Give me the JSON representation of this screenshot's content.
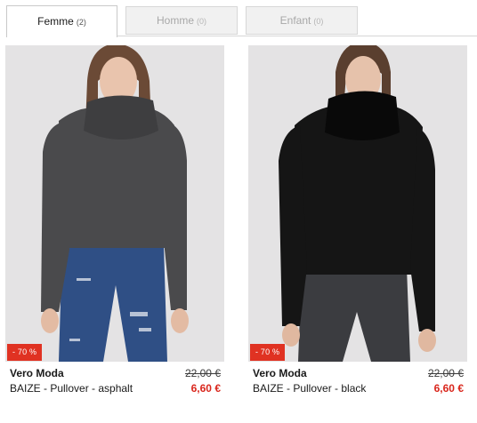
{
  "tabs": [
    {
      "label": "Femme",
      "count": "(2)",
      "active": true
    },
    {
      "label": "Homme",
      "count": "(0)",
      "active": false
    },
    {
      "label": "Enfant",
      "count": "(0)",
      "active": false
    }
  ],
  "products": [
    {
      "badge": "- 70 %",
      "brand": "Vero Moda",
      "name": "BAIZE - Pullover - asphalt",
      "old_price": "22,00 €",
      "new_price": "6,60 €",
      "sweater_color": "#4a4a4c",
      "jeans_color": "#2f4f85"
    },
    {
      "badge": "- 70 %",
      "brand": "Vero Moda",
      "name": "BAIZE - Pullover - black",
      "old_price": "22,00 €",
      "new_price": "6,60 €",
      "sweater_color": "#151515",
      "jeans_color": "#3b3c40"
    }
  ],
  "colors": {
    "sale_badge": "#e03222",
    "sale_price": "#d9261c"
  }
}
